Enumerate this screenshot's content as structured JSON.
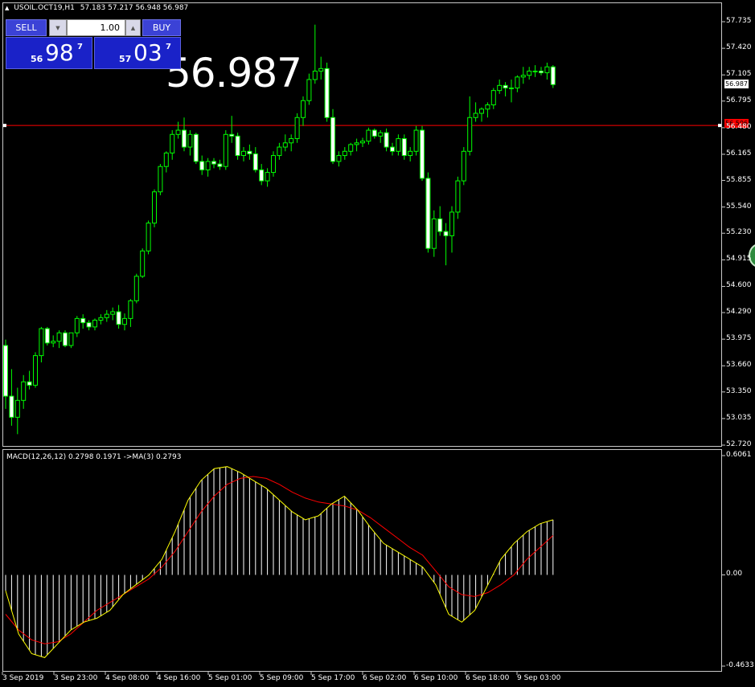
{
  "chart_header": {
    "symbol": "USOIL.OCT19,H1",
    "ohlc": "57.183 57.217 56.948 56.987"
  },
  "trade_panel": {
    "sell_label": "SELL",
    "buy_label": "BUY",
    "volume": "1.00",
    "sell_price_small": "56",
    "sell_price_large": "98",
    "sell_price_sup": "7",
    "buy_price_small": "57",
    "buy_price_large": "03",
    "buy_price_sup": "7"
  },
  "big_price": "56.987",
  "price_axis": {
    "labels": [
      "57.735",
      "57.420",
      "57.105",
      "56.795",
      "56.480",
      "56.165",
      "55.855",
      "55.540",
      "55.230",
      "54.915",
      "54.600",
      "54.290",
      "53.975",
      "53.660",
      "53.350",
      "53.035",
      "52.720"
    ],
    "current_price_tag": "56.987",
    "level_tag": "56.506"
  },
  "macd": {
    "label": "MACD(12,26,12) 0.2798 0.1971  ->MA(3) 0.2793",
    "axis_labels": [
      "0.6061",
      "0.00",
      "-0.4633"
    ]
  },
  "time_axis": [
    "3 Sep 2019",
    "3 Sep 23:00",
    "4 Sep 08:00",
    "4 Sep 16:00",
    "5 Sep 01:00",
    "5 Sep 09:00",
    "5 Sep 17:00",
    "6 Sep 02:00",
    "6 Sep 10:00",
    "6 Sep 18:00",
    "9 Sep 03:00"
  ],
  "colors": {
    "background": "#000000",
    "candle": "#00ff00",
    "candle_bull_body": "#000000",
    "candle_bear_body": "#ffffff",
    "level_line": "#ff0000",
    "macd_signal": "#ffff00",
    "macd_ma": "#ff0000",
    "histogram": "#ffffff",
    "panel_blue": "#1a22c8"
  },
  "chart_data": {
    "type": "candlestick",
    "timeframe": "H1",
    "ylim": [
      52.6,
      57.9
    ],
    "level": 56.506,
    "candles": [
      [
        53.9,
        53.97,
        53.15,
        53.3
      ],
      [
        53.3,
        53.62,
        52.95,
        53.05
      ],
      [
        53.05,
        53.4,
        52.85,
        53.25
      ],
      [
        53.25,
        53.55,
        53.15,
        53.47
      ],
      [
        53.47,
        53.6,
        53.38,
        53.43
      ],
      [
        53.43,
        53.82,
        53.4,
        53.78
      ],
      [
        53.78,
        54.12,
        53.7,
        54.1
      ],
      [
        54.1,
        54.12,
        53.9,
        53.93
      ],
      [
        53.93,
        54.02,
        53.88,
        53.95
      ],
      [
        53.95,
        54.08,
        53.87,
        54.05
      ],
      [
        54.05,
        54.08,
        53.88,
        53.9
      ],
      [
        53.9,
        54.05,
        53.87,
        54.05
      ],
      [
        54.05,
        54.25,
        54.0,
        54.22
      ],
      [
        54.22,
        54.27,
        54.1,
        54.17
      ],
      [
        54.17,
        54.2,
        54.08,
        54.12
      ],
      [
        54.12,
        54.22,
        54.08,
        54.2
      ],
      [
        54.2,
        54.27,
        54.15,
        54.23
      ],
      [
        54.23,
        54.32,
        54.18,
        54.27
      ],
      [
        54.27,
        54.35,
        54.2,
        54.3
      ],
      [
        54.3,
        54.38,
        54.1,
        54.15
      ],
      [
        54.15,
        54.28,
        54.08,
        54.22
      ],
      [
        54.22,
        54.45,
        54.12,
        54.43
      ],
      [
        54.43,
        54.75,
        54.4,
        54.72
      ],
      [
        54.72,
        55.05,
        54.7,
        55.02
      ],
      [
        55.02,
        55.38,
        54.98,
        55.35
      ],
      [
        55.35,
        55.75,
        55.3,
        55.72
      ],
      [
        55.72,
        56.05,
        55.68,
        56.02
      ],
      [
        56.02,
        56.2,
        55.95,
        56.18
      ],
      [
        56.18,
        56.45,
        56.1,
        56.4
      ],
      [
        56.4,
        56.55,
        56.35,
        56.45
      ],
      [
        56.45,
        56.6,
        56.2,
        56.25
      ],
      [
        56.25,
        56.45,
        56.15,
        56.4
      ],
      [
        56.4,
        56.42,
        56.05,
        56.08
      ],
      [
        56.08,
        56.15,
        55.92,
        55.98
      ],
      [
        55.98,
        56.12,
        55.9,
        56.08
      ],
      [
        56.08,
        56.12,
        56.0,
        56.05
      ],
      [
        56.05,
        56.1,
        55.98,
        56.02
      ],
      [
        56.02,
        56.45,
        55.98,
        56.4
      ],
      [
        56.4,
        56.62,
        56.3,
        56.38
      ],
      [
        56.38,
        56.42,
        56.1,
        56.15
      ],
      [
        56.15,
        56.25,
        56.08,
        56.2
      ],
      [
        56.2,
        56.28,
        56.1,
        56.17
      ],
      [
        56.17,
        56.25,
        55.95,
        55.98
      ],
      [
        55.98,
        56.05,
        55.8,
        55.85
      ],
      [
        55.85,
        56.0,
        55.78,
        55.95
      ],
      [
        55.95,
        56.2,
        55.9,
        56.15
      ],
      [
        56.15,
        56.3,
        56.1,
        56.25
      ],
      [
        56.25,
        56.4,
        56.2,
        56.3
      ],
      [
        56.3,
        56.4,
        56.2,
        56.35
      ],
      [
        56.35,
        56.65,
        56.3,
        56.6
      ],
      [
        56.6,
        56.85,
        56.5,
        56.8
      ],
      [
        56.8,
        57.12,
        56.75,
        57.05
      ],
      [
        57.05,
        57.7,
        57.0,
        57.15
      ],
      [
        57.15,
        57.32,
        57.05,
        57.18
      ],
      [
        57.18,
        57.25,
        56.55,
        56.6
      ],
      [
        56.6,
        56.7,
        56.05,
        56.08
      ],
      [
        56.08,
        56.2,
        56.02,
        56.15
      ],
      [
        56.15,
        56.25,
        56.1,
        56.2
      ],
      [
        56.2,
        56.3,
        56.15,
        56.28
      ],
      [
        56.28,
        56.35,
        56.2,
        56.3
      ],
      [
        56.3,
        56.36,
        56.25,
        56.32
      ],
      [
        56.32,
        56.48,
        56.28,
        56.45
      ],
      [
        56.45,
        56.47,
        56.35,
        56.38
      ],
      [
        56.38,
        56.45,
        56.3,
        56.42
      ],
      [
        56.42,
        56.47,
        56.2,
        56.25
      ],
      [
        56.25,
        56.3,
        56.15,
        56.2
      ],
      [
        56.2,
        56.4,
        56.15,
        56.35
      ],
      [
        56.35,
        56.4,
        56.1,
        56.15
      ],
      [
        56.15,
        56.25,
        56.08,
        56.2
      ],
      [
        56.2,
        56.5,
        56.15,
        56.45
      ],
      [
        56.45,
        56.5,
        55.85,
        55.88
      ],
      [
        55.88,
        55.95,
        55.0,
        55.05
      ],
      [
        55.05,
        55.5,
        54.95,
        55.4
      ],
      [
        55.4,
        55.55,
        55.2,
        55.25
      ],
      [
        55.25,
        55.35,
        54.85,
        55.2
      ],
      [
        55.2,
        55.55,
        55.0,
        55.48
      ],
      [
        55.48,
        55.9,
        55.4,
        55.85
      ],
      [
        55.85,
        56.25,
        55.8,
        56.2
      ],
      [
        56.2,
        56.85,
        56.15,
        56.6
      ],
      [
        56.6,
        56.78,
        56.55,
        56.65
      ],
      [
        56.65,
        56.72,
        56.55,
        56.7
      ],
      [
        56.7,
        56.78,
        56.6,
        56.75
      ],
      [
        56.75,
        56.95,
        56.7,
        56.92
      ],
      [
        56.92,
        57.05,
        56.88,
        56.98
      ],
      [
        56.98,
        57.02,
        56.85,
        56.95
      ],
      [
        56.95,
        57.05,
        56.78,
        56.95
      ],
      [
        56.95,
        57.1,
        56.9,
        57.08
      ],
      [
        57.08,
        57.2,
        57.0,
        57.1
      ],
      [
        57.1,
        57.2,
        57.05,
        57.15
      ],
      [
        57.15,
        57.22,
        57.08,
        57.15
      ],
      [
        57.15,
        57.2,
        57.1,
        57.13
      ],
      [
        57.13,
        57.25,
        57.05,
        57.2
      ],
      [
        57.2,
        57.22,
        56.95,
        56.99
      ]
    ],
    "macd_signal": [
      -0.08,
      -0.3,
      -0.4,
      -0.42,
      -0.35,
      -0.28,
      -0.24,
      -0.22,
      -0.18,
      -0.1,
      -0.05,
      0.0,
      0.08,
      0.22,
      0.38,
      0.48,
      0.54,
      0.55,
      0.52,
      0.48,
      0.44,
      0.38,
      0.32,
      0.28,
      0.3,
      0.36,
      0.4,
      0.33,
      0.24,
      0.16,
      0.12,
      0.08,
      0.04,
      -0.05,
      -0.2,
      -0.24,
      -0.18,
      -0.05,
      0.08,
      0.16,
      0.22,
      0.26,
      0.28
    ],
    "macd_ma": [
      -0.2,
      -0.28,
      -0.33,
      -0.35,
      -0.34,
      -0.3,
      -0.24,
      -0.18,
      -0.14,
      -0.1,
      -0.06,
      -0.02,
      0.04,
      0.12,
      0.22,
      0.32,
      0.4,
      0.46,
      0.49,
      0.5,
      0.49,
      0.46,
      0.42,
      0.39,
      0.37,
      0.36,
      0.35,
      0.33,
      0.29,
      0.24,
      0.19,
      0.14,
      0.1,
      0.02,
      -0.06,
      -0.1,
      -0.11,
      -0.09,
      -0.05,
      0.0,
      0.08,
      0.14,
      0.2
    ],
    "macd_ylim": [
      -0.4633,
      0.6061
    ]
  }
}
